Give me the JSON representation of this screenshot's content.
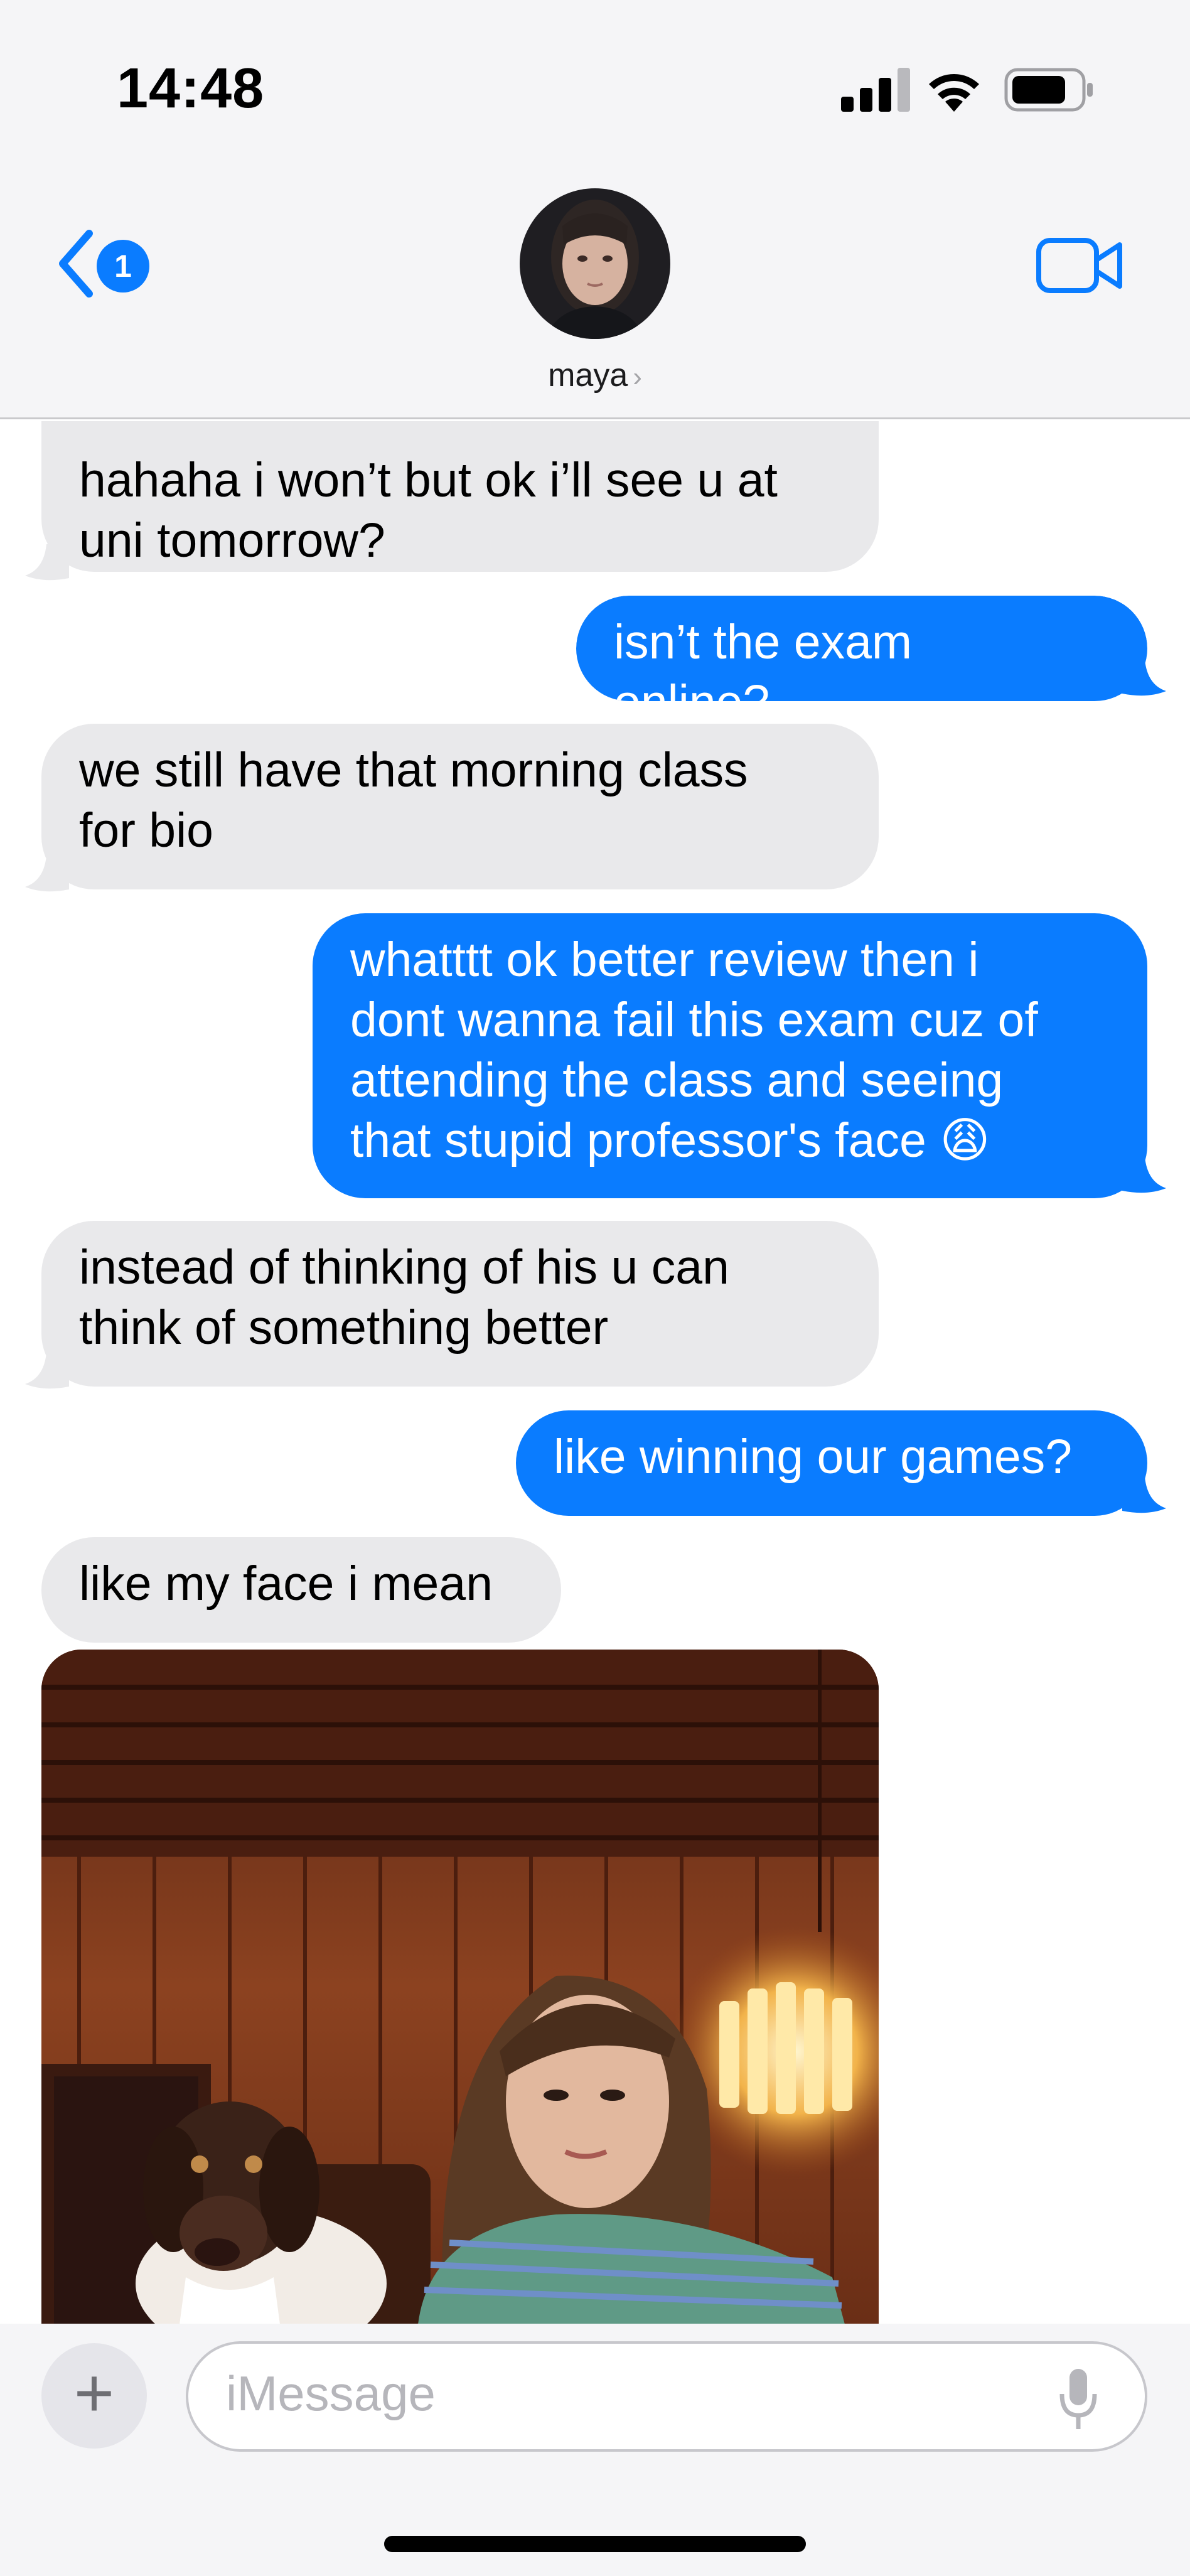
{
  "status_bar": {
    "time": "14:48"
  },
  "header": {
    "back_badge": "1",
    "contact_name": "maya",
    "contact_chevron": "›"
  },
  "messages": [
    {
      "from": "them",
      "text": "hahaha i won’t but ok i’ll see u at\nuni tomorrow?"
    },
    {
      "from": "me",
      "text": "isn’t the exam\nonline?"
    },
    {
      "from": "them",
      "text": "we still have that morning class\nfor bio"
    },
    {
      "from": "me",
      "text": "whatttt ok better review then i\ndont wanna fail this exam cuz of\nattending the class and seeing\nthat stupid professor's face 😩"
    },
    {
      "from": "them",
      "text": "instead of thinking of his u can\nthink of something better"
    },
    {
      "from": "me",
      "text": "like winning our games?"
    },
    {
      "from": "them",
      "text": "like my face i mean"
    }
  ],
  "composer": {
    "plus": "+",
    "placeholder": "iMessage"
  },
  "colors": {
    "sent": "#0a7cff",
    "received": "#e9e9eb",
    "accent": "#0a7cff"
  },
  "icons": [
    "back-chevron-icon",
    "video-camera-icon",
    "microphone-icon",
    "signal-icon",
    "wifi-icon",
    "battery-icon"
  ]
}
